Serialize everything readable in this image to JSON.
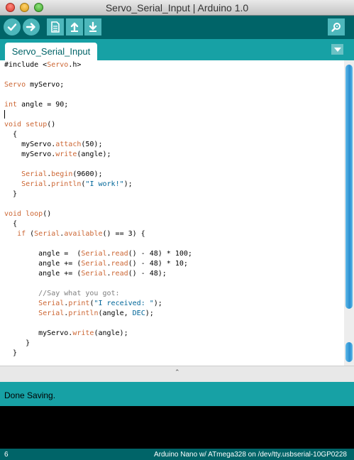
{
  "window": {
    "title": "Servo_Serial_Input | Arduino 1.0"
  },
  "toolbar": {
    "buttons": [
      "verify-icon",
      "upload-icon",
      "new-icon",
      "open-icon",
      "save-icon",
      "serial-monitor-icon"
    ]
  },
  "tabs": [
    {
      "label": "Servo_Serial_Input"
    }
  ],
  "status": {
    "message": "Done Saving."
  },
  "footer": {
    "line_number": "6",
    "board": "Arduino Nano w/ ATmega328 on /dev/tty.usbserial-10GP0228"
  },
  "colors": {
    "toolbar": "#006468",
    "tabs": "#17a1a5",
    "keyword": "#cc6633",
    "string": "#006699",
    "comment": "#7e7e7e"
  },
  "code_lines": [
    [
      [
        "#include <",
        ""
      ],
      [
        "Servo",
        "kw"
      ],
      [
        ".h>",
        ""
      ]
    ],
    [],
    [
      [
        "Servo",
        "kw"
      ],
      [
        " myServo;",
        ""
      ]
    ],
    [],
    [
      [
        "int",
        "kw"
      ],
      [
        " angle = 90;",
        ""
      ]
    ],
    [
      [
        "|caret",
        ""
      ]
    ],
    [
      [
        "void",
        "kw"
      ],
      [
        " ",
        ""
      ],
      [
        "setup",
        "kw"
      ],
      [
        "()",
        ""
      ]
    ],
    [
      [
        "  {",
        ""
      ]
    ],
    [
      [
        "    myServo.",
        ""
      ],
      [
        "attach",
        "kw"
      ],
      [
        "(50);",
        ""
      ]
    ],
    [
      [
        "    myServo.",
        ""
      ],
      [
        "write",
        "kw"
      ],
      [
        "(angle);",
        ""
      ]
    ],
    [],
    [
      [
        "    ",
        ""
      ],
      [
        "Serial",
        "kw"
      ],
      [
        ".",
        ""
      ],
      [
        "begin",
        "kw"
      ],
      [
        "(9600);",
        ""
      ]
    ],
    [
      [
        "    ",
        ""
      ],
      [
        "Serial",
        "kw"
      ],
      [
        ".",
        ""
      ],
      [
        "println",
        "kw"
      ],
      [
        "(",
        ""
      ],
      [
        "\"I work!\"",
        "str"
      ],
      [
        ");",
        ""
      ]
    ],
    [
      [
        "  }",
        ""
      ]
    ],
    [],
    [
      [
        "void",
        "kw"
      ],
      [
        " ",
        ""
      ],
      [
        "loop",
        "kw"
      ],
      [
        "()",
        ""
      ]
    ],
    [
      [
        "  {",
        ""
      ]
    ],
    [
      [
        "   ",
        ""
      ],
      [
        "if",
        "kw"
      ],
      [
        " (",
        ""
      ],
      [
        "Serial",
        "kw"
      ],
      [
        ".",
        ""
      ],
      [
        "available",
        "kw"
      ],
      [
        "() == 3) {",
        ""
      ]
    ],
    [],
    [
      [
        "        angle =  (",
        ""
      ],
      [
        "Serial",
        "kw"
      ],
      [
        ".",
        ""
      ],
      [
        "read",
        "kw"
      ],
      [
        "() - 48) * 100;",
        ""
      ]
    ],
    [
      [
        "        angle += (",
        ""
      ],
      [
        "Serial",
        "kw"
      ],
      [
        ".",
        ""
      ],
      [
        "read",
        "kw"
      ],
      [
        "() - 48) * 10;",
        ""
      ]
    ],
    [
      [
        "        angle += (",
        ""
      ],
      [
        "Serial",
        "kw"
      ],
      [
        ".",
        ""
      ],
      [
        "read",
        "kw"
      ],
      [
        "() - 48);",
        ""
      ]
    ],
    [],
    [
      [
        "        //Say what you got:",
        "cmt"
      ]
    ],
    [
      [
        "        ",
        ""
      ],
      [
        "Serial",
        "kw"
      ],
      [
        ".",
        ""
      ],
      [
        "print",
        "kw"
      ],
      [
        "(",
        ""
      ],
      [
        "\"I received: \"",
        "str"
      ],
      [
        ");",
        ""
      ]
    ],
    [
      [
        "        ",
        ""
      ],
      [
        "Serial",
        "kw"
      ],
      [
        ".",
        ""
      ],
      [
        "println",
        "kw"
      ],
      [
        "(angle, ",
        ""
      ],
      [
        "DEC",
        "str"
      ],
      [
        ");",
        ""
      ]
    ],
    [],
    [
      [
        "        myServo.",
        ""
      ],
      [
        "write",
        "kw"
      ],
      [
        "(angle);",
        ""
      ]
    ],
    [
      [
        "     }",
        ""
      ]
    ],
    [
      [
        "  }",
        ""
      ]
    ]
  ]
}
